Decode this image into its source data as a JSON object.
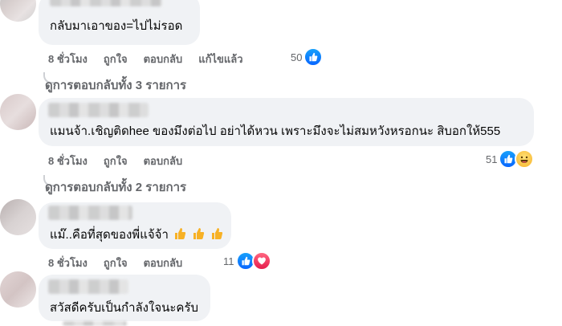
{
  "comments": [
    {
      "text": "กลับมาเอาของ=ไปไม่รอด",
      "actions": [
        "8 ชั่วโมง",
        "ถูกใจ",
        "ตอบกลับ",
        "แก้ไขแล้ว"
      ],
      "reaction_count": "50",
      "reactions": [
        "like-icon"
      ],
      "replies_label": "ดูการตอบกลับทั้ง 3 รายการ"
    },
    {
      "text": "แมนจ้า.เชิญติดhee ของมึงต่อไป อย่าได้หวน เพราะมึงจะไม่สมหวังหรอกนะ สิบอกให้555",
      "actions": [
        "8 ชั่วโมง",
        "ถูกใจ",
        "ตอบกลับ"
      ],
      "reaction_count": "51",
      "reactions": [
        "like-icon",
        "haha-icon"
      ],
      "replies_label": "ดูการตอบกลับทั้ง 2 รายการ"
    },
    {
      "text": "แม๊..คือที่สุดของพี่แจ้จ้า",
      "emoji": "thumbs-up-icon ×3",
      "actions": [
        "8 ชั่วโมง",
        "ถูกใจ",
        "ตอบกลับ"
      ],
      "reaction_count": "11",
      "reactions": [
        "like-icon",
        "love-icon"
      ]
    },
    {
      "text": "สวัสดีครับเป็นกำลังใจนะครับ"
    }
  ],
  "colors": {
    "bubble": "#f0f2f5",
    "meta_text": "#65676b",
    "like_blue": "#0866ff",
    "love_red": "#e61e4d",
    "haha_yellow": "#f7b125"
  }
}
